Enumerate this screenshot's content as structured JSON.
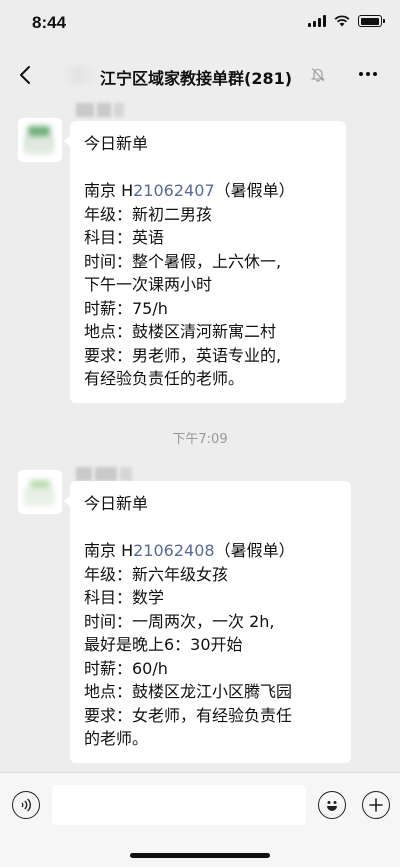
{
  "status_bar": {
    "time": "8:44"
  },
  "nav": {
    "title": "江宁区域家教接单群(281)"
  },
  "messages": [
    {
      "lines": [
        "今日新单",
        "",
        {
          "prefix": "南京 H",
          "code": "21062407",
          "suffix": "（暑假单）"
        },
        "年级：新初二男孩",
        "科目：英语",
        "时间：整个暑假，上六休一,",
        "下午一次课两小时",
        "时薪：75/h",
        "地点：鼓楼区清河新寓二村",
        "要求：男老师，英语专业的,",
        "有经验负责任的老师。"
      ]
    },
    {
      "lines": [
        "今日新单",
        "",
        {
          "prefix": "南京 H",
          "code": "21062408",
          "suffix": "（暑假单）"
        },
        "年级：新六年级女孩",
        "科目：数学",
        "时间：一周两次，一次 2h,",
        "最好是晚上6：30开始",
        "时薪：60/h",
        "地点：鼓楼区龙江小区腾飞园",
        "要求：女老师，有经验负责任",
        "的老师。"
      ]
    }
  ],
  "timestamp": "下午7:09",
  "input_bar": {
    "value": ""
  },
  "colors": {
    "background": "#ededed",
    "bubble": "#ffffff",
    "order_code": "#576b95",
    "input_bar": "#f6f6f6"
  },
  "icons": [
    "back-arrow-icon",
    "mute-bell-icon",
    "more-dots-icon",
    "voice-icon",
    "emoji-icon",
    "plus-icon"
  ]
}
